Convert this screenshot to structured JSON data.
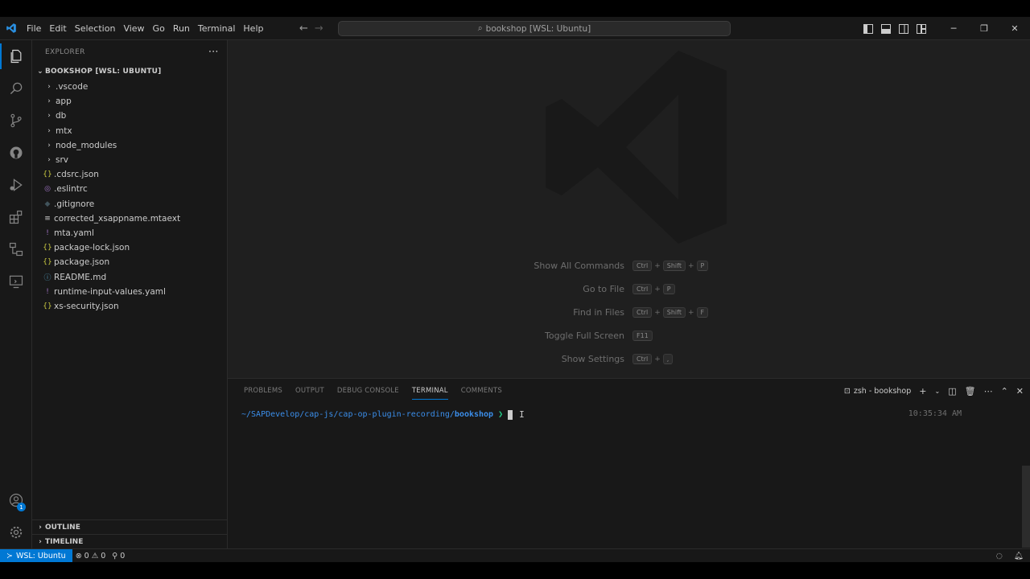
{
  "menu": [
    "File",
    "Edit",
    "Selection",
    "View",
    "Go",
    "Run",
    "Terminal",
    "Help"
  ],
  "command_center": "bookshop [WSL: Ubuntu]",
  "explorer": {
    "title": "EXPLORER",
    "folder": "BOOKSHOP [WSL: UBUNTU]",
    "items": [
      {
        "name": ".vscode",
        "type": "folder",
        "icon": "chevron-right-icon",
        "glyph": "›",
        "color": "#cccccc"
      },
      {
        "name": "app",
        "type": "folder",
        "icon": "chevron-right-icon",
        "glyph": "›",
        "color": "#cccccc"
      },
      {
        "name": "db",
        "type": "folder",
        "icon": "chevron-right-icon",
        "glyph": "›",
        "color": "#cccccc"
      },
      {
        "name": "mtx",
        "type": "folder",
        "icon": "chevron-right-icon",
        "glyph": "›",
        "color": "#cccccc"
      },
      {
        "name": "node_modules",
        "type": "folder",
        "icon": "chevron-right-icon",
        "glyph": "›",
        "color": "#cccccc"
      },
      {
        "name": "srv",
        "type": "folder",
        "icon": "chevron-right-icon",
        "glyph": "›",
        "color": "#cccccc"
      },
      {
        "name": ".cdsrc.json",
        "type": "file",
        "icon": "json-file-icon",
        "glyph": "{}",
        "color": "#cbcb41"
      },
      {
        "name": ".eslintrc",
        "type": "file",
        "icon": "eslint-file-icon",
        "glyph": "◎",
        "color": "#a074c4"
      },
      {
        "name": ".gitignore",
        "type": "file",
        "icon": "git-file-icon",
        "glyph": "◆",
        "color": "#41535b"
      },
      {
        "name": "corrected_xsappname.mtaext",
        "type": "file",
        "icon": "text-file-icon",
        "glyph": "≡",
        "color": "#cccccc"
      },
      {
        "name": "mta.yaml",
        "type": "file",
        "icon": "yaml-file-icon",
        "glyph": "!",
        "color": "#a074c4"
      },
      {
        "name": "package-lock.json",
        "type": "file",
        "icon": "json-file-icon",
        "glyph": "{}",
        "color": "#cbcb41"
      },
      {
        "name": "package.json",
        "type": "file",
        "icon": "json-file-icon",
        "glyph": "{}",
        "color": "#cbcb41"
      },
      {
        "name": "README.md",
        "type": "file",
        "icon": "info-file-icon",
        "glyph": "ⓘ",
        "color": "#519aba"
      },
      {
        "name": "runtime-input-values.yaml",
        "type": "file",
        "icon": "yaml-file-icon",
        "glyph": "!",
        "color": "#a074c4"
      },
      {
        "name": "xs-security.json",
        "type": "file",
        "icon": "json-file-icon",
        "glyph": "{}",
        "color": "#cbcb41"
      }
    ],
    "outline": "OUTLINE",
    "timeline": "TIMELINE"
  },
  "welcome_shortcuts": [
    {
      "label": "Show All Commands",
      "keys": [
        "Ctrl",
        "Shift",
        "P"
      ]
    },
    {
      "label": "Go to File",
      "keys": [
        "Ctrl",
        "P"
      ]
    },
    {
      "label": "Find in Files",
      "keys": [
        "Ctrl",
        "Shift",
        "F"
      ]
    },
    {
      "label": "Toggle Full Screen",
      "keys": [
        "F11"
      ]
    },
    {
      "label": "Show Settings",
      "keys": [
        "Ctrl",
        ","
      ]
    }
  ],
  "panel": {
    "tabs": [
      "PROBLEMS",
      "OUTPUT",
      "DEBUG CONSOLE",
      "TERMINAL",
      "COMMENTS"
    ],
    "active_tab": "TERMINAL",
    "terminal_name": "zsh - bookshop",
    "prompt_path": "~/SAPDevelop/cap-js/cap-op-plugin-recording/",
    "prompt_dir": "bookshop",
    "prompt_symbol": "❯",
    "time": "10:35:34 AM"
  },
  "status": {
    "remote": "WSL: Ubuntu",
    "errors": "0",
    "warnings": "0",
    "ports": "0"
  },
  "accounts_badge": "1",
  "colors": {
    "accent": "#0078d4",
    "prompt": "#3b8eea",
    "arrow": "#23d18b"
  }
}
